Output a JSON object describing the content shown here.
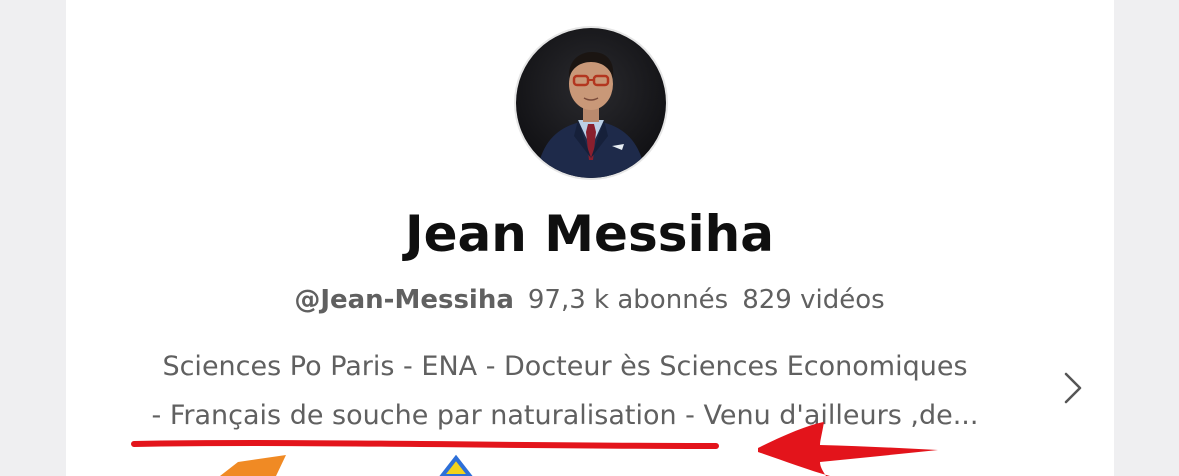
{
  "channel": {
    "name": "Jean Messiha",
    "handle": "@Jean-Messiha",
    "subscribers": "97,3 k abonnés",
    "videos": "829 vidéos",
    "description_line1": "Sciences Po Paris - ENA - Docteur ès Sciences Economiques",
    "description_line2": "- Français de souche par naturalisation - Venu d'ailleurs ,de..."
  },
  "icons": {
    "avatar": "profile-photo",
    "more": "chevron-right-icon"
  },
  "colors": {
    "annotation_red": "#e3141b",
    "annotation_orange": "#f08a24",
    "annotation_blue": "#2d6fd8",
    "annotation_yellow": "#f2d21b"
  }
}
